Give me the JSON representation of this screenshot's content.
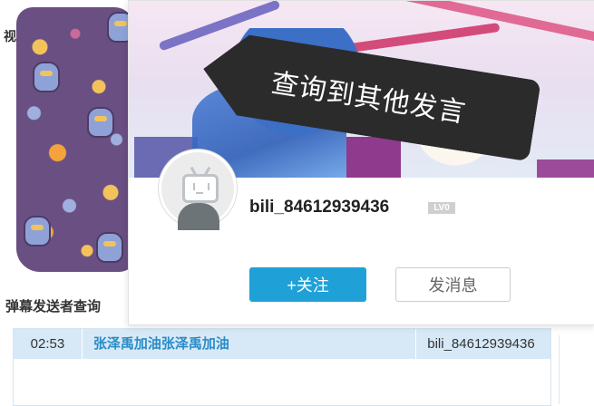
{
  "background": {
    "section_label_top": "视",
    "section_label": "弹幕发送者查询"
  },
  "results": {
    "rows": [
      {
        "time": "02:53",
        "content": "张泽禹加油张泽禹加油",
        "user": "bili_84612939436"
      }
    ]
  },
  "card": {
    "overlay_text": "查询到其他发言",
    "username": "bili_84612939436",
    "level": "LV0",
    "follow_label": "+关注",
    "message_label": "发消息"
  },
  "colors": {
    "accent": "#1fa1d8",
    "row_highlight": "#d7e9f7",
    "danmaku_text": "#2a8cc7"
  }
}
